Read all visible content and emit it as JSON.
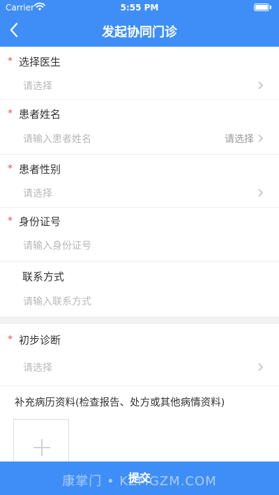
{
  "status_bar": {
    "carrier": "Carrier",
    "time": "5:55 PM"
  },
  "nav": {
    "title": "发起协同门诊"
  },
  "form": {
    "required_mark": "*",
    "doctor": {
      "label": "选择医生",
      "placeholder": "请选择"
    },
    "patient_name": {
      "label": "患者姓名",
      "placeholder": "请输入患者姓名",
      "picker": "请选择"
    },
    "patient_gender": {
      "label": "患者性别",
      "placeholder": "请选择"
    },
    "id_number": {
      "label": "身份证号",
      "placeholder": "请输入身份证号"
    },
    "contact": {
      "label": "联系方式",
      "placeholder": "请输入联系方式"
    },
    "diagnosis": {
      "label": "初步诊断",
      "placeholder": "请选择"
    },
    "attachments": {
      "label": "补充病历资料(检查报告、处方或其他病情资料)"
    }
  },
  "submit_label": "提交",
  "watermark": "康掌门 • KZMGZM.COM",
  "colors": {
    "primary": "#3f8ef7",
    "required": "#e84d4d",
    "placeholder": "#b8b8b8"
  }
}
